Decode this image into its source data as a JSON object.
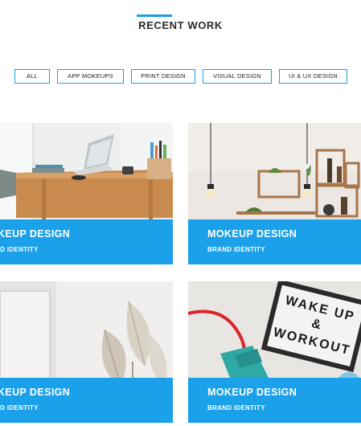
{
  "section": {
    "title": "RECENT WORK"
  },
  "filters": [
    {
      "label": "ALL"
    },
    {
      "label": "APP MOKEUPS"
    },
    {
      "label": "PRINT DESIGN"
    },
    {
      "label": "VISUAL DESIGN"
    },
    {
      "label": "UI & UX DESIGN"
    }
  ],
  "portfolio": [
    {
      "title": "MOKEUP DESIGN",
      "subtitle": "BRAND IDENTITY",
      "photo": "desk-laptop"
    },
    {
      "title": "MOKEUP DESIGN",
      "subtitle": "BRAND IDENTITY",
      "photo": "shelves-lamps"
    },
    {
      "title": "MOKEUP DESIGN",
      "subtitle": "BRAND IDENTITY",
      "photo": "palm-leaves"
    },
    {
      "title": "MOKEUP DESIGN",
      "subtitle": "BRAND IDENTITY",
      "photo": "lightbox-sign"
    }
  ],
  "lightbox": {
    "line1": "WAKE UP",
    "line2": "&",
    "line3": "WORKOUT"
  },
  "colors": {
    "accent": "#1e9ee8",
    "overlay": "#1ba0ea"
  }
}
